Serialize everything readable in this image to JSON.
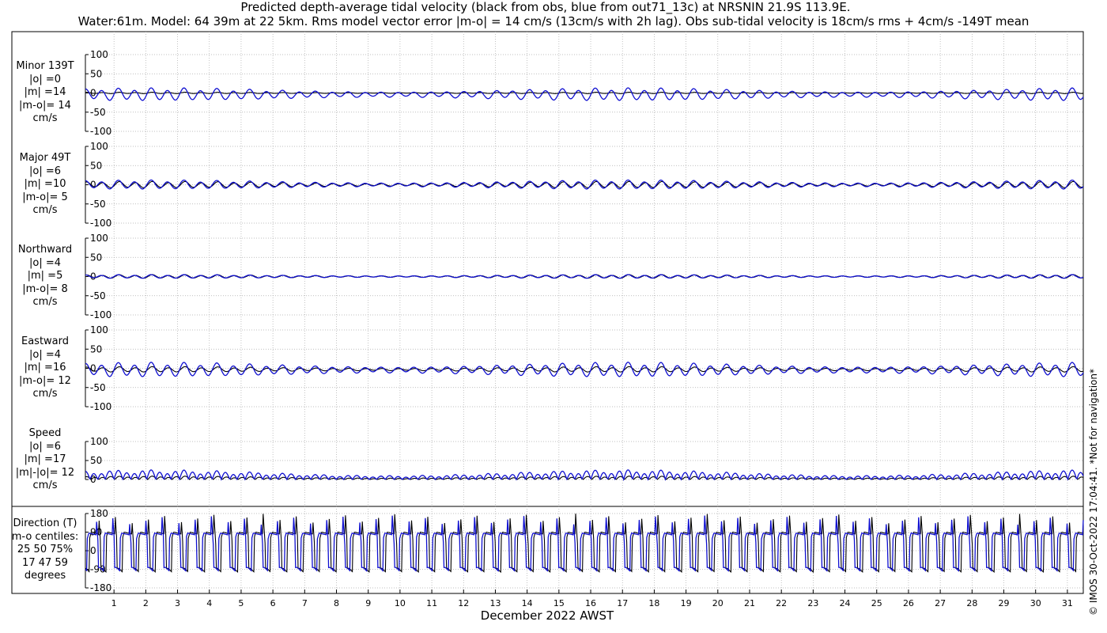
{
  "title_line1": "Predicted depth-average tidal velocity (black from obs, blue from out71_13c) at NRSNIN 21.9S 113.9E.",
  "title_line2": "Water:61m. Model: 64 39m at 22 5km. Rms model vector error |m-o| = 14 cm/s (13cm/s with 2h lag). Obs sub-tidal velocity is 18cm/s rms + 4cm/s -149T mean",
  "copyright": "© IMOS 30-Oct-2022 17:04:41. *Not for navigation*",
  "colors": {
    "obs": "#000000",
    "model": "#1010d0",
    "grid": "#aaaaaa"
  },
  "panels": [
    {
      "id": "minor",
      "label_lines": [
        "Minor 139T",
        "|o| =0",
        "|m| =14",
        "|m-o|= 14",
        "cm/s"
      ]
    },
    {
      "id": "major",
      "label_lines": [
        "Major 49T",
        "|o| =6",
        "|m| =10",
        "|m-o|= 5",
        "cm/s"
      ]
    },
    {
      "id": "north",
      "label_lines": [
        "Northward",
        "|o| =4",
        "|m| =5",
        "|m-o|= 8",
        "cm/s"
      ]
    },
    {
      "id": "east",
      "label_lines": [
        "Eastward",
        "|o| =4",
        "|m| =16",
        "|m-o|= 12",
        "cm/s"
      ]
    },
    {
      "id": "speed",
      "label_lines": [
        "Speed",
        "|o| =6",
        "|m| =17",
        "|m|-|o|= 12",
        "cm/s"
      ]
    },
    {
      "id": "direction",
      "label_lines": [
        "Direction (T)",
        "m-o centiles:",
        "25  50  75%",
        "17  47  59",
        "degrees"
      ]
    }
  ],
  "chart_data": {
    "type": "line",
    "xlabel": "December 2022 AWST",
    "x_ticks": [
      "1",
      "2",
      "3",
      "4",
      "5",
      "6",
      "7",
      "8",
      "9",
      "10",
      "11",
      "12",
      "13",
      "14",
      "15",
      "16",
      "17",
      "18",
      "19",
      "20",
      "21",
      "22",
      "23",
      "24",
      "25",
      "26",
      "27",
      "28",
      "29",
      "30",
      "31"
    ],
    "xlim_days": [
      0.1,
      31.5
    ],
    "series_names": [
      "obs",
      "model"
    ],
    "panels": [
      {
        "id": "minor",
        "ylim": [
          -100,
          100
        ],
        "yticks": [
          "100",
          "50",
          "0",
          "-50",
          "-100"
        ],
        "obs": {
          "amp": 1.5,
          "offset": 0
        },
        "model": {
          "amp": 14,
          "offset": -4
        }
      },
      {
        "id": "major",
        "ylim": [
          -100,
          100
        ],
        "yticks": [
          "100",
          "50",
          "0",
          "-50",
          "-100"
        ],
        "obs": {
          "amp": 7,
          "offset": 0
        },
        "model": {
          "amp": 10,
          "offset": 0
        }
      },
      {
        "id": "north",
        "ylim": [
          -100,
          100
        ],
        "yticks": [
          "100",
          "50",
          "0",
          "-50",
          "-100"
        ],
        "obs": {
          "amp": 4,
          "offset": 0
        },
        "model": {
          "amp": 4,
          "offset": 0
        }
      },
      {
        "id": "east",
        "ylim": [
          -100,
          100
        ],
        "yticks": [
          "100",
          "50",
          "0",
          "-50",
          "-100"
        ],
        "obs": {
          "amp": 6,
          "offset": -3
        },
        "model": {
          "amp": 16,
          "offset": -4
        }
      },
      {
        "id": "speed",
        "ylim": [
          0,
          100
        ],
        "yticks": [
          "100",
          "50",
          "0"
        ],
        "obs": {
          "amp": 6,
          "offset": 0
        },
        "model": {
          "amp": 17,
          "offset": 0
        }
      },
      {
        "id": "direction",
        "ylim": [
          -180,
          180
        ],
        "yticks": [
          "180",
          "90",
          "0",
          "-90",
          "-180"
        ]
      }
    ]
  }
}
